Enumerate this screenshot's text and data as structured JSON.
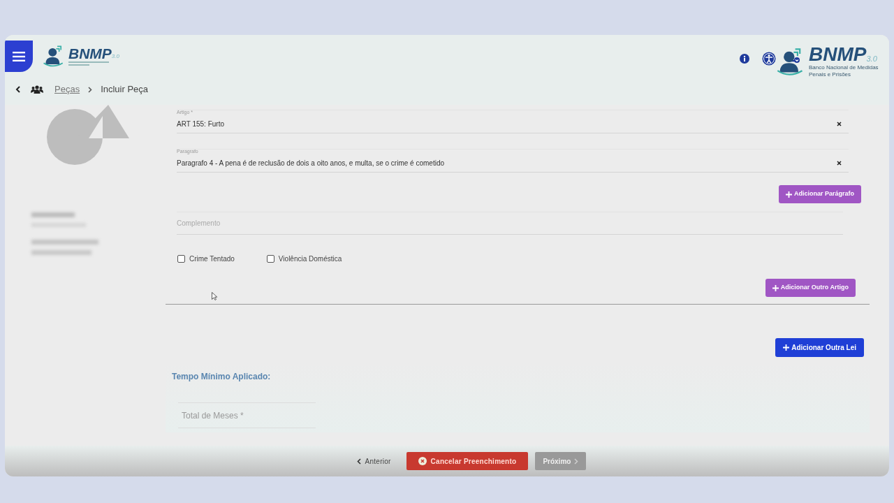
{
  "overlay_logo": {
    "name": "BNMP",
    "version": "3.0",
    "subtitle": "Banco Nacional de Medidas Penais e Prisões"
  },
  "header": {
    "logo": {
      "name": "BNMP",
      "version": "3.0"
    }
  },
  "breadcrumb": [
    {
      "label": "Peças",
      "link": true
    },
    {
      "label": "Incluir Peça",
      "link": false
    }
  ],
  "fields": [
    {
      "kind": "select",
      "label": "Artigo *",
      "value": "ART 155: Furto"
    },
    {
      "kind": "select",
      "label": "Paragrafo",
      "value": "Paragrafo 4 - A pena é de reclusão de dois a oito anos, e multa, se o crime é cometido"
    },
    {
      "kind": "button",
      "label": "Adicionar Parágrafo"
    },
    {
      "kind": "text",
      "placeholder": "Complemento"
    }
  ],
  "checkboxes": [
    {
      "label": "Crime Tentado",
      "checked": false
    },
    {
      "label": "Violência Doméstica",
      "checked": false
    }
  ],
  "add_article_button": "Adicionar Outro Artigo",
  "add_law_button": "Adicionar Outra Lei",
  "section_title": "Tempo Mínimo Aplicado:",
  "months_field": {
    "placeholder": "Total de Meses *"
  },
  "footer": {
    "back": "Anterior",
    "cancel": "Cancelar Preenchimento",
    "next": {
      "label": "Próximo",
      "disabled": true
    }
  }
}
